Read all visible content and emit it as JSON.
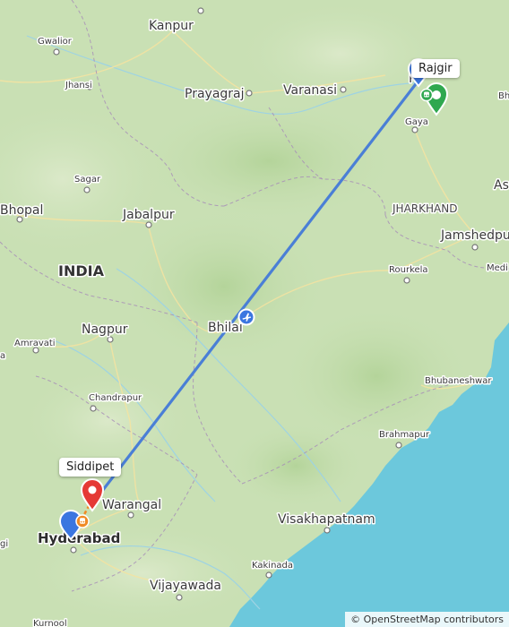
{
  "map": {
    "country_label": "INDIA",
    "state_label": "JHARKHAND",
    "cities_major": [
      "Kanpur",
      "Prayagraj",
      "Varanasi",
      "Bhopal",
      "Jabalpur",
      "Nagpur",
      "Jamshedpur",
      "Warangal",
      "Visakhapatnam",
      "Vijayawada",
      "Hyderabad",
      "Bhilai"
    ],
    "cities_minor": [
      "Gwalior",
      "Jhansi",
      "Sagar",
      "Gaya",
      "Rourkela",
      "Amravati",
      "Chandrapur",
      "Brahmapur",
      "Bhubaneshwar",
      "Kakinada",
      "Kurnool"
    ],
    "labels": {
      "kanpur": "Kanpur",
      "gwalior": "Gwalior",
      "jhansi": "Jhansi",
      "prayagraj": "Prayagraj",
      "varanasi": "Varanasi",
      "gaya": "Gaya",
      "sagar": "Sagar",
      "bhopal": "Bhopal",
      "jabalpur": "Jabalpur",
      "jharkhand": "JHARKHAND",
      "jamshedpur": "Jamshedpur",
      "india": "INDIA",
      "rourkela": "Rourkela",
      "medi": "Medi",
      "as": "As",
      "bh": "Bh",
      "nagpur": "Nagpur",
      "bhilai": "Bhilai",
      "amravati": "Amravati",
      "bhubaneshwar": "Bhubaneshwar",
      "chandrapur": "Chandrapur",
      "brahmapur": "Brahmapur",
      "warangal": "Warangal",
      "hyderabad": "Hyderabad",
      "visakhapatnam": "Visakhapatnam",
      "kakinada": "Kakinada",
      "vijayawada": "Vijayawada",
      "kurnool": "Kurnool",
      "gi": "gi",
      "a": "a",
      "p": "P"
    }
  },
  "route": {
    "origin": "Rajgir",
    "destination": "Siddipet",
    "mode_icon": "airplane-icon",
    "route_color": "#4a7fd6",
    "origin_marker_color": "#2fa84f",
    "destination_marker_color": "#e53935",
    "airport_marker_color": "#3b76e0",
    "rail_marker_color": "#f08a24"
  },
  "attribution": "© OpenStreetMap contributors"
}
